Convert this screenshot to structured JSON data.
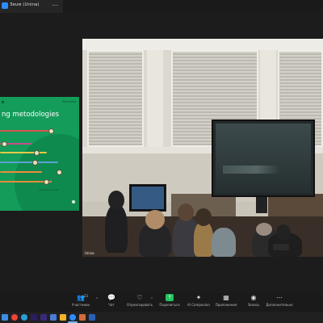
{
  "window": {
    "title": "Зeuм (Unina)",
    "more_glyph": "⋯"
  },
  "slide": {
    "heading": "ng metodologies",
    "logo": "Mnemonic",
    "caption": "Strategy square",
    "bar_colors": [
      "#d9534f",
      "#c44d8e",
      "#e7c948",
      "#5aa1d6",
      "#f08a3c"
    ]
  },
  "camera": {
    "label": "Unina"
  },
  "toolbar": {
    "participants": {
      "label": "Участники",
      "count": "23",
      "icon": "participants-icon"
    },
    "chat": {
      "label": "Чат",
      "icon": "chat-icon"
    },
    "react": {
      "label": "Отреагировать",
      "icon": "heart-icon"
    },
    "share": {
      "label": "Поделиться",
      "icon": "share-screen-icon"
    },
    "ai": {
      "label": "AI Companion",
      "icon": "ai-companion-icon"
    },
    "apps": {
      "label": "Приложения",
      "icon": "apps-icon"
    },
    "record": {
      "label": "Запись",
      "icon": "record-icon"
    },
    "more": {
      "label": "Дополнительно",
      "icon": "more-icon"
    },
    "caret": "⌃"
  },
  "taskbar": {
    "apps": [
      "windows-start-icon",
      "chrome-icon",
      "edge-icon",
      "premiere-icon",
      "premiere-icon",
      "store-icon",
      "explorer-icon",
      "zoom-icon",
      "photo-icon",
      "word-icon"
    ]
  }
}
